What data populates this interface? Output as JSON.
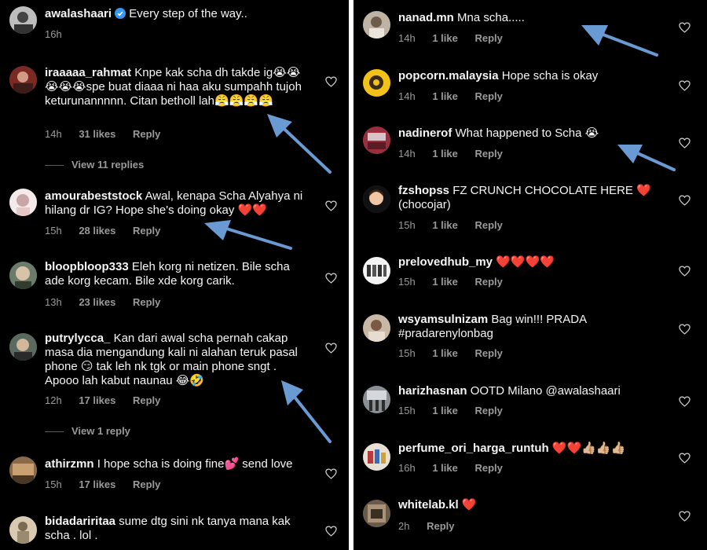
{
  "caption": {
    "username": "awalashaari",
    "text": "Every step of the way..",
    "time": "16h"
  },
  "left_comments": [
    {
      "username": "iraaaaa_rahmat",
      "text": "Knpe kak scha dh takde ig😭😭😭😭😭spe buat diaaa ni haa aku sumpahh tujoh keturunannnnn. Citan betholl lah😤😤😤😤",
      "time": "14h",
      "likes": "31 likes",
      "reply": "Reply",
      "view_replies": "View 11 replies"
    },
    {
      "username": "amourabeststock",
      "text": "Awal, kenapa Scha Alyahya ni hilang dr IG? Hope she's doing okay ❤️❤️",
      "time": "15h",
      "likes": "28 likes",
      "reply": "Reply"
    },
    {
      "username": "bloopbloop333",
      "text": "Eleh korg ni netizen. Bile scha ade korg kecam. Bile xde korg carik.",
      "time": "13h",
      "likes": "23 likes",
      "reply": "Reply"
    },
    {
      "username": "putrylycca_",
      "text": "Kan dari awal scha pernah cakap masa dia mengandung kali ni alahan teruk pasal phone 😏 tak leh nk tgk or main phone sngt . Apooo lah kabut naunau 😂🤣",
      "time": "12h",
      "likes": "17 likes",
      "reply": "Reply",
      "view_replies": "View 1 reply"
    },
    {
      "username": "athirzmn",
      "text": "I hope scha is doing fine💕 send love",
      "time": "15h",
      "likes": "17 likes",
      "reply": "Reply"
    },
    {
      "username": "bidadariritaa",
      "text": "sume dtg sini nk tanya mana kak scha . lol .",
      "time": "",
      "likes": "",
      "reply": ""
    }
  ],
  "right_comments": [
    {
      "username": "nanad.mn",
      "text": "Mna scha.....",
      "time": "14h",
      "likes": "1 like",
      "reply": "Reply"
    },
    {
      "username": "popcorn.malaysia",
      "text": "Hope scha is okay",
      "time": "14h",
      "likes": "1 like",
      "reply": "Reply"
    },
    {
      "username": "nadinerof",
      "text": "What happened to Scha 😭",
      "time": "14h",
      "likes": "1 like",
      "reply": "Reply"
    },
    {
      "username": "fzshopss",
      "text": "FZ CRUNCH CHOCOLATE HERE ❤️ (chocojar)",
      "time": "15h",
      "likes": "1 like",
      "reply": "Reply"
    },
    {
      "username": "prelovedhub_my",
      "text": "❤️❤️❤️❤️",
      "time": "15h",
      "likes": "1 like",
      "reply": "Reply"
    },
    {
      "username": "wsyamsulnizam",
      "text": "Bag win!!! PRADA #pradarenylonbag",
      "time": "15h",
      "likes": "1 like",
      "reply": "Reply"
    },
    {
      "username": "harizhasnan",
      "text": "OOTD Milano @awalashaari",
      "time": "15h",
      "likes": "1 like",
      "reply": "Reply"
    },
    {
      "username": "perfume_ori_harga_runtuh",
      "text": "❤️❤️👍🏼👍🏼👍🏼",
      "time": "16h",
      "likes": "1 like",
      "reply": "Reply"
    },
    {
      "username": "whitelab.kl",
      "text": "❤️",
      "time": "2h",
      "likes": "",
      "reply": "Reply"
    }
  ],
  "colors": {
    "background": "#000000",
    "text": "#f5f5f5",
    "meta": "#9a9a9a",
    "arrow": "#6a9ad4",
    "verified": "#3897f0"
  },
  "icons": {
    "like": "heart-outline-icon",
    "verified": "verified-badge-icon",
    "annotation": "arrow-annotation"
  }
}
